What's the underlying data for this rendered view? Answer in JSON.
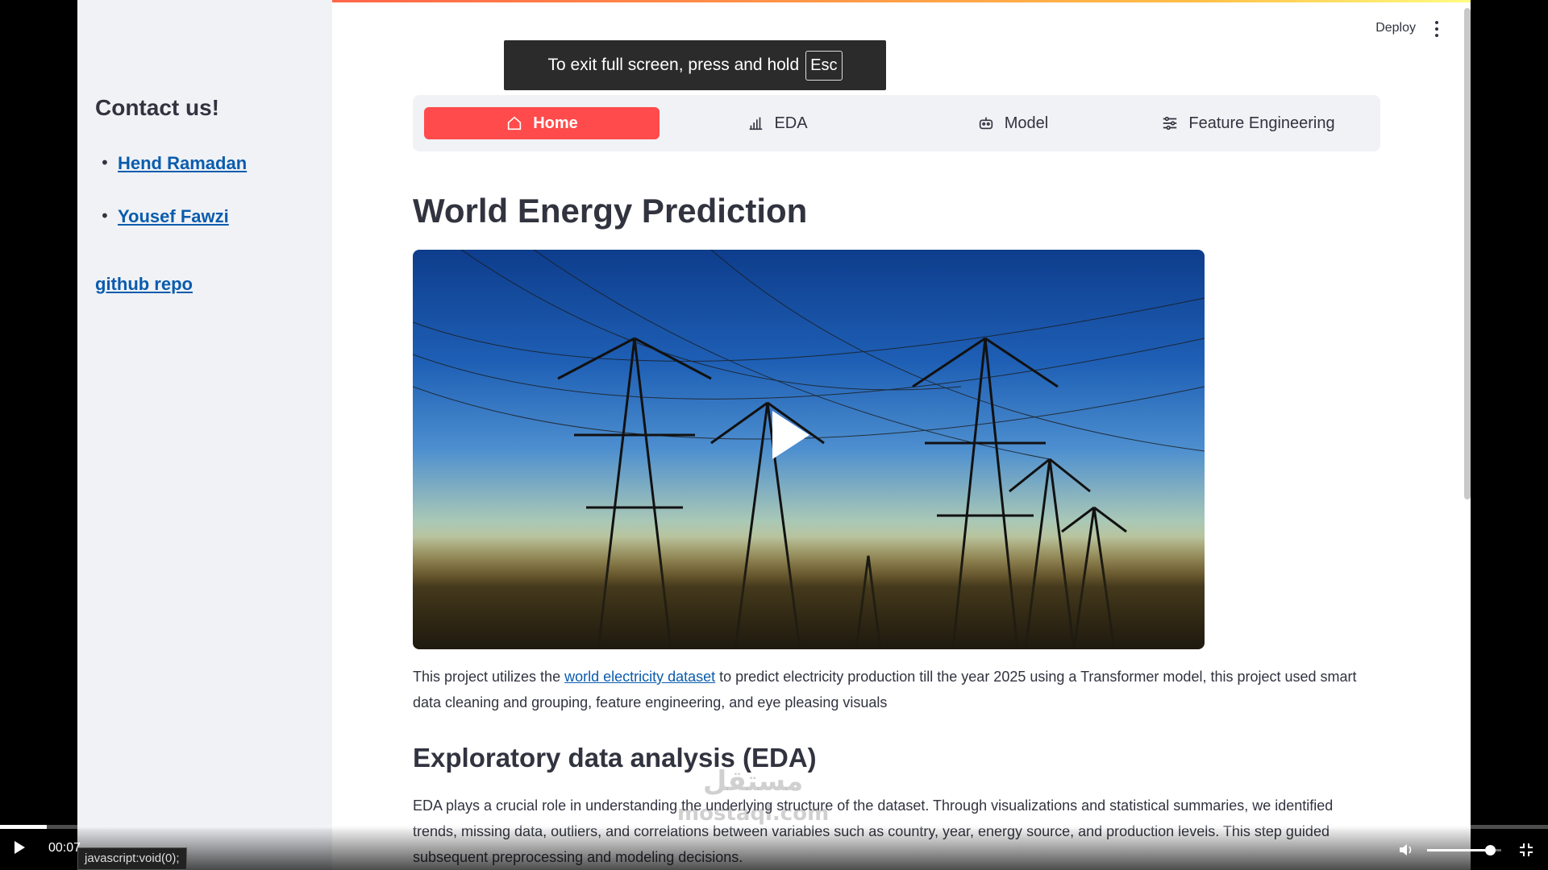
{
  "sidebar": {
    "heading": "Contact us!",
    "contacts": [
      "Hend Ramadan",
      "Yousef Fawzi"
    ],
    "repo_link": "github repo"
  },
  "header": {
    "deploy_label": "Deploy",
    "menu_icon": "kebab-menu-icon"
  },
  "fullscreen_toast": {
    "text": "To exit full screen, press and hold",
    "key": "Esc"
  },
  "nav": {
    "tabs": [
      {
        "label": "Home",
        "icon": "home-icon",
        "active": true
      },
      {
        "label": "EDA",
        "icon": "bar-chart-icon",
        "active": false
      },
      {
        "label": "Model",
        "icon": "robot-icon",
        "active": false
      },
      {
        "label": "Feature Engineering",
        "icon": "sliders-icon",
        "active": false
      }
    ],
    "accent": "#ff4b4b"
  },
  "main": {
    "title": "World Energy Prediction",
    "intro_before": "This project utilizes the ",
    "intro_link": "world electricity dataset",
    "intro_after": " to predict electricity production till the year 2025 using a Transformer model, this project used smart data cleaning and grouping, feature engineering, and eye pleasing visuals",
    "eda_heading": "Exploratory data analysis (EDA)",
    "eda_text": "EDA plays a crucial role in understanding the underlying structure of the dataset. Through visualizations and statistical summaries, we identified trends, missing data, outliers, and correlations between variables such as country, year, energy source, and production levels. This step guided subsequent preprocessing and modeling decisions."
  },
  "player": {
    "time": "00:07",
    "progress": 0.03,
    "volume": 0.85,
    "status_url": "javascript:void(0);",
    "watermark_ar": "مستقل",
    "watermark_en": "mostaql.com"
  }
}
